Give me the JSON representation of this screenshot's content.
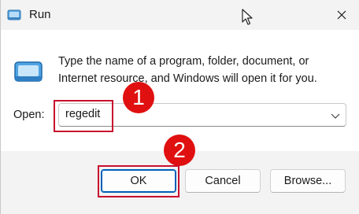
{
  "window": {
    "title": "Run",
    "icon": "run-app-icon",
    "close_icon": "close-icon"
  },
  "dialog": {
    "icon": "run-app-icon",
    "description": "Type the name of a program, folder, document, or Internet resource, and Windows will open it for you.",
    "open_label": "Open:",
    "open_value": "regedit"
  },
  "buttons": {
    "ok": "OK",
    "cancel": "Cancel",
    "browse": "Browse..."
  },
  "annotations": {
    "step1": "1",
    "step2": "2",
    "color": "#e01010"
  },
  "colors": {
    "accent": "#005fb8",
    "highlight_border": "#c8102e"
  }
}
